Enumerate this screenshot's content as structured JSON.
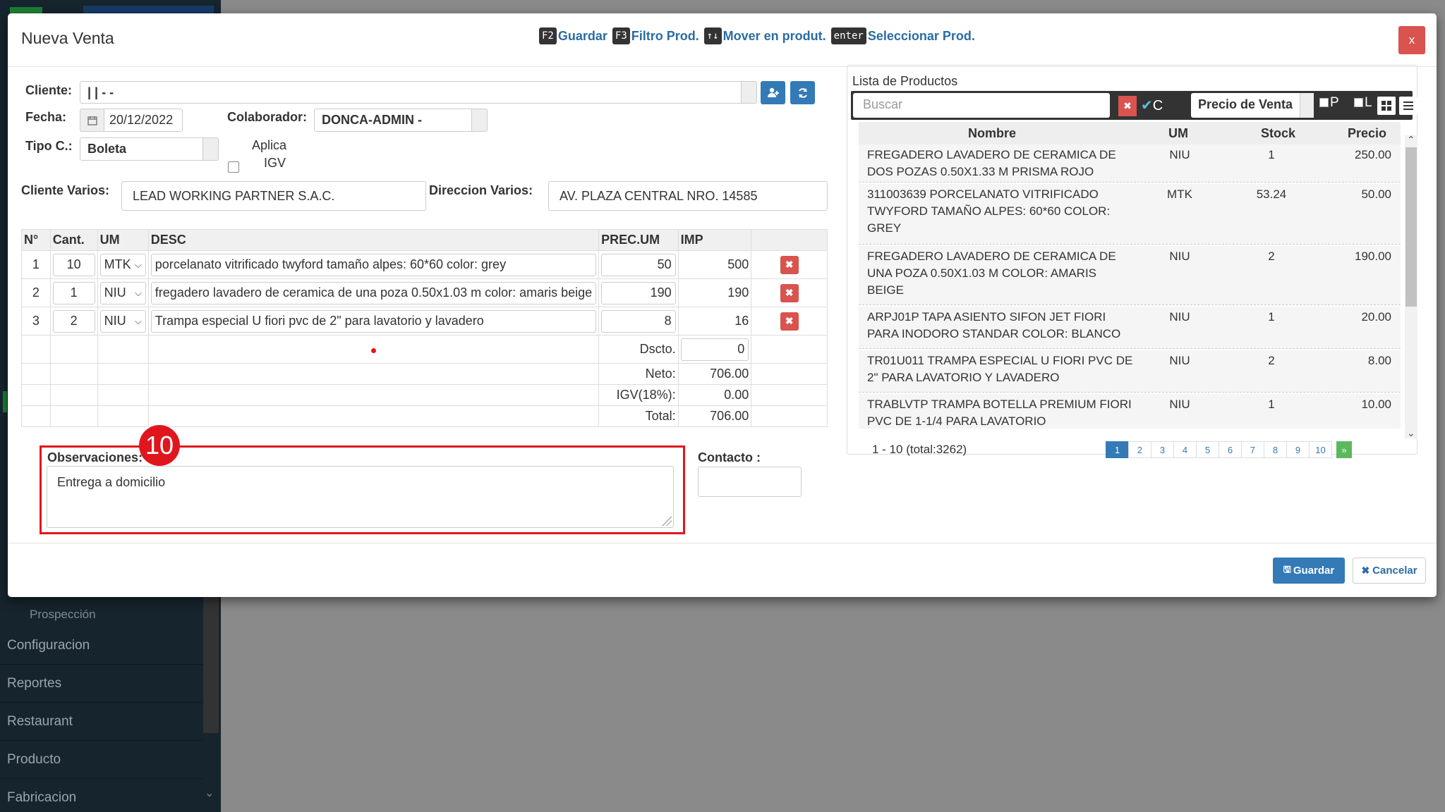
{
  "background": {
    "sidebar_sub_item": "Prospección",
    "sidebar_items": [
      "Configuracion",
      "Reportes",
      "Restaurant",
      "Producto",
      "Fabricacion"
    ]
  },
  "modal": {
    "title": "Nueva Venta",
    "close_label": "x",
    "shortcuts": [
      {
        "key": "F2",
        "label": "Guardar"
      },
      {
        "key": "F3",
        "label": "Filtro Prod."
      },
      {
        "key": "↑↓",
        "label": "Mover en produt."
      },
      {
        "key": "enter",
        "label": "Seleccionar Prod."
      }
    ]
  },
  "form": {
    "cliente_label": "Cliente:",
    "cliente_value": "| | - -",
    "fecha_label": "Fecha:",
    "fecha_value": "20/12/2022",
    "colaborador_label": "Colaborador:",
    "colaborador_value": "DONCA-ADMIN -",
    "tipo_label": "Tipo C.:",
    "tipo_value": "Boleta",
    "aplica_igv_label1": "Aplica",
    "aplica_igv_label2": "IGV",
    "cliente_varios_label": "Cliente Varios:",
    "cliente_varios_value": "LEAD WORKING PARTNER S.A.C.",
    "direccion_varios_label": "Direccion Varios:",
    "direccion_varios_value": "AV. PLAZA CENTRAL NRO. 14585"
  },
  "detail": {
    "headers": [
      "N°",
      "Cant.",
      "UM",
      "DESC",
      "PREC.UM",
      "IMP"
    ],
    "rows": [
      {
        "n": "1",
        "cant": "10",
        "um": "MTK",
        "desc": "porcelanato vitrificado twyford tamaño alpes: 60*60 color: grey",
        "prec": "50",
        "imp": "500"
      },
      {
        "n": "2",
        "cant": "1",
        "um": "NIU",
        "desc": "fregadero lavadero de ceramica de una poza 0.50x1.03 m color: amaris beige",
        "prec": "190",
        "imp": "190"
      },
      {
        "n": "3",
        "cant": "2",
        "um": "NIU",
        "desc": "Trampa especial U fiori pvc de 2\" para lavatorio y lavadero",
        "prec": "8",
        "imp": "16"
      }
    ],
    "dscto_label": "Dscto.",
    "dscto_value": "0",
    "neto_label": "Neto:",
    "neto_value": "706.00",
    "igv_label": "IGV(18%):",
    "igv_value": "0.00",
    "total_label": "Total:",
    "total_value": "706.00"
  },
  "observaciones": {
    "label": "Observaciones:",
    "value": "Entrega a domicilio",
    "badge": "10"
  },
  "contacto": {
    "label": "Contacto :",
    "value": ""
  },
  "footer": {
    "save_label": "Guardar",
    "cancel_label": "Cancelar"
  },
  "products": {
    "title": "Lista de Productos",
    "search_placeholder": "Buscar",
    "c_label": "C",
    "price_select": "Precio de Venta",
    "p_label": "P",
    "l_label": "L",
    "headers": {
      "name": "Nombre",
      "um": "UM",
      "stock": "Stock",
      "price": "Precio"
    },
    "rows": [
      {
        "name": "FREGADERO LAVADERO DE CERAMICA DE DOS POZAS 0.50X1.33 M PRISMA ROJO",
        "um": "NIU",
        "stock": "1",
        "price": "250.00"
      },
      {
        "name": "311003639 PORCELANATO VITRIFICADO TWYFORD TAMAÑO ALPES: 60*60 COLOR: GREY",
        "um": "MTK",
        "stock": "53.24",
        "price": "50.00"
      },
      {
        "name": "FREGADERO LAVADERO DE CERAMICA DE UNA POZA 0.50X1.03 M COLOR: AMARIS BEIGE",
        "um": "NIU",
        "stock": "2",
        "price": "190.00"
      },
      {
        "name": "ARPJ01P TAPA ASIENTO SIFON JET FIORI PARA INODORO STANDAR COLOR: BLANCO",
        "um": "NIU",
        "stock": "1",
        "price": "20.00"
      },
      {
        "name": "TR01U011 TRAMPA ESPECIAL U FIORI PVC DE 2\" PARA LAVATORIO Y LAVADERO",
        "um": "NIU",
        "stock": "2",
        "price": "8.00"
      },
      {
        "name": "TRABLVTP TRAMPA BOTELLA PREMIUM FIORI PVC DE 1-1/4 PARA LAVATORIO",
        "um": "NIU",
        "stock": "1",
        "price": "10.00"
      }
    ],
    "pager_info": "1 - 10 (total:3262)",
    "pages": [
      "1",
      "2",
      "3",
      "4",
      "5",
      "6",
      "7",
      "8",
      "9",
      "10"
    ],
    "next_label": "»"
  }
}
